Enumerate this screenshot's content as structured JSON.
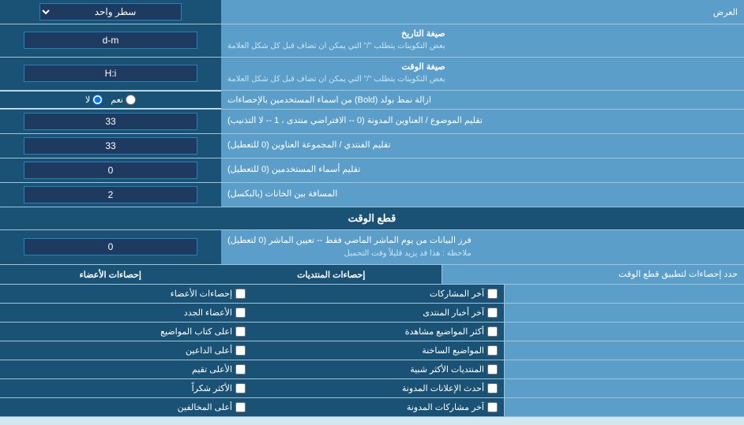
{
  "header": {
    "title": "العرض",
    "single_row_label": "سطر واحد"
  },
  "date_format": {
    "label": "صيغة التاريخ",
    "sublabel": "بعض التكوينات يتطلب \"/\" التي يمكن ان تضاف قبل كل شكل العلامة",
    "value": "d-m"
  },
  "time_format": {
    "label": "صيغة الوقت",
    "sublabel": "بعض التكوينات يتطلب \"/\" التي يمكن ان تضاف قبل كل شكل العلامة",
    "value": "H:i"
  },
  "bold_remove": {
    "label": "ازالة نمط بولد (Bold) من اسماء المستخدمين بالإحصاءات",
    "option_yes": "نعم",
    "option_no": "لا",
    "selected": "no"
  },
  "threads_sort": {
    "label": "تقليم الموضوع / العناوين المدونة (0 -- الافتراضي منتدى ، 1 -- لا التذنيب)",
    "value": "33"
  },
  "forum_trim": {
    "label": "تقليم الفنتدي / المجموعة العناوين (0 للتعطيل)",
    "value": "33"
  },
  "users_trim": {
    "label": "تقليم أسماء المستخدمين (0 للتعطيل)",
    "value": "0"
  },
  "column_spacing": {
    "label": "المسافة بين الخانات (بالبكسل)",
    "value": "2"
  },
  "time_cut_section": {
    "title": "قطع الوقت"
  },
  "time_cut_filter": {
    "label": "فرز البيانات من يوم الماشر الماضي فقط -- تعيين الماشر (0 لتعطيل)",
    "note": "ملاحظة : هذا قد يزيد قليلاً وقت التحميل",
    "value": "0"
  },
  "stats_define": {
    "label": "حدد إحصاءات لتطبيق قطع الوقت"
  },
  "stats_posts_header": "إحصاءات المنتديات",
  "stats_members_header": "إحصاءات الأعضاء",
  "stats_posts_items": [
    "آخر المشاركات",
    "آخر أخبار المنتدى",
    "أكثر المواضيع مشاهدة",
    "المواضيع الساخنة",
    "المنتديات الأكثر شبية",
    "أحدث الإعلانات المدونة",
    "آخر مشاركات المدونة"
  ],
  "stats_members_items": [
    "إحصاءات الأعضاء",
    "الأعضاء الجدد",
    "اعلى كتاب المواضيع",
    "أعلى الداعين",
    "الأعلى تقيم",
    "الأكثر شكراً",
    "أعلى المخالفين"
  ]
}
